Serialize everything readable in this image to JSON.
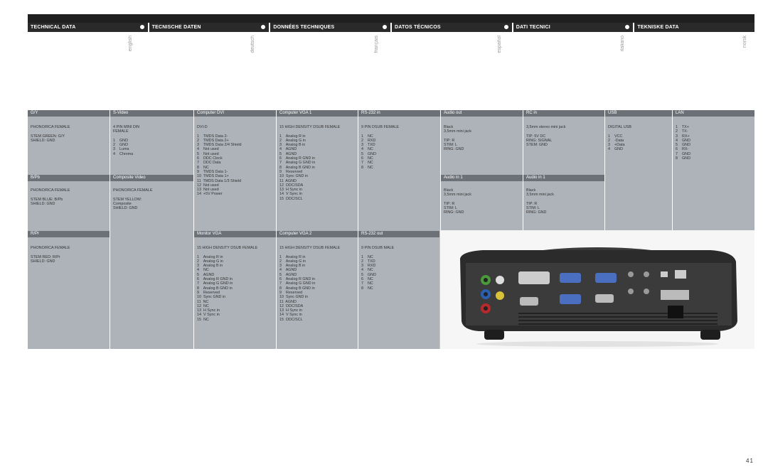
{
  "languages": [
    {
      "header": "TECHNICAL  DATA",
      "side": "english"
    },
    {
      "header": "TECNISCHE DATEN",
      "side": "deutsch"
    },
    {
      "header": "DONNÉES TECHNIQUES",
      "side": "français"
    },
    {
      "header": "DATOS TÉCNICOS",
      "side": "español"
    },
    {
      "header": "DATI TECNICI",
      "side": "italiano"
    },
    {
      "header": "TEKNISKE DATA",
      "side": "norsk"
    }
  ],
  "row1_headers": [
    "G/Y",
    "S-Video",
    "Computer DVI",
    "Computer VGA 1",
    "RS-232 in",
    "Audio out",
    "RC in",
    "USB",
    "LAN"
  ],
  "row1_texts": [
    "PHONO/RCA FEMALE\n\nSTEM GREEN: G/Y\nSHIELD: GND",
    "4 PIN MINI DIN\nFEMALE\n\n1    GND\n2    GND\n3    Luma\n4    Chroma",
    "DVI-D\n\n1    TMDS Data 2-\n2    TMDS Data 2+\n3    TMDS Data 2/4 Shield\n4    Not used\n5    Not used\n6    DDC Clock\n7    DDC Data\n8    NC\n9    TMDS Data 1-\n10  TMDS Data 1+\n11  TMDS Data 1/3 Shield\n12  Not used\n13  Not used\n14  +5V Power",
    "15 HIGH DENSITY DSUB FEMALE\n\n1    Analog R in\n2    Analog G in\n3    Analog B in\n4    AGND\n5    AGND\n6    Analog R GND in\n7    Analog G GND in\n8    Analog B GND in\n9    Reserved\n10  Sync GND in\n11  AGND\n12  DDC/SDA\n13  H Sync in\n14  V Sync in\n15  DDC/SCL",
    "9 PIN DSUB FEMALE\n\n1    NC\n2    RXD\n3    TXD\n4    NC\n5    GND\n6    NC\n7    NC\n8    NC",
    "Black\n3,5mm mini jack\n\nTIP: R\nSTIM: L\nRING: GND",
    "3,5mm stereo mini jack\n\nTIP: 5V DC\nRING: SIGNAL\nSTEM: GND",
    "DIGITAL USB\n\n1    VCC\n2    -Data\n3    +Data\n4    GND",
    "1    TX+\n2    TX-\n3    RX+\n4    GND\n5    GND\n6    RX-\n7    GND\n8    GND"
  ],
  "row2_headers": [
    "B/Pb",
    "Composite Video",
    "Audio in 1",
    "Audio in 1"
  ],
  "row2_texts": [
    "PHONO/RCA FEMALE\n\nSTEM BLUE: B/Pb\nSHIELD: GND",
    "PHONO/RCA FEMALE\n\nSTEM YELLOW:\nComposite\nSHIELD: GND",
    "Black\n3,5mm mini jack\n\nTIP: R\nSTIM: L\nRING: GND",
    "Black\n3,5mm mini jack\n\nTIP: R\nSTIM: L\nRING: GND"
  ],
  "row3_headers": [
    "R/Pr",
    "Monitor VGA",
    "Computer VGA 2",
    "RS-232 out"
  ],
  "row3_texts": [
    "PHONO/RCA FEMALE\n\nSTEM RED: R/Pr\nSHIELD: GND",
    "15 HIGH DENSITY DSUB FEMALE\n\n1    Analog R in\n2    Analog G in\n3    Analog B in\n4    NC\n5    AGND\n6    Analog R GND in\n7    Analog G GND in\n8    Analog B GND in\n9    Reserved\n10  Sync GND in\n11  NC\n12  NC\n13  H Sync in\n14  V Sync in\n15  NC",
    "15 HIGH DENSITY DSUB FEMALE\n\n1    Analog R in\n2    Analog G in\n3    Analog B in\n4    AGND\n5    AGND\n6    Analog R GND in\n7    Analog G GND in\n8    Analog B GND in\n9    Reserved\n10  Sync GND in\n11  AGND\n12  DDC/SDA\n13  H Sync in\n14  V Sync in\n15  DDC/SCL",
    "9 PIN DSUB MALE\n\n1    NC\n2    TXD\n3    RXD\n4    NC\n5    GND\n6    NC\n7    NC\n8    NC"
  ],
  "page_number": "41"
}
